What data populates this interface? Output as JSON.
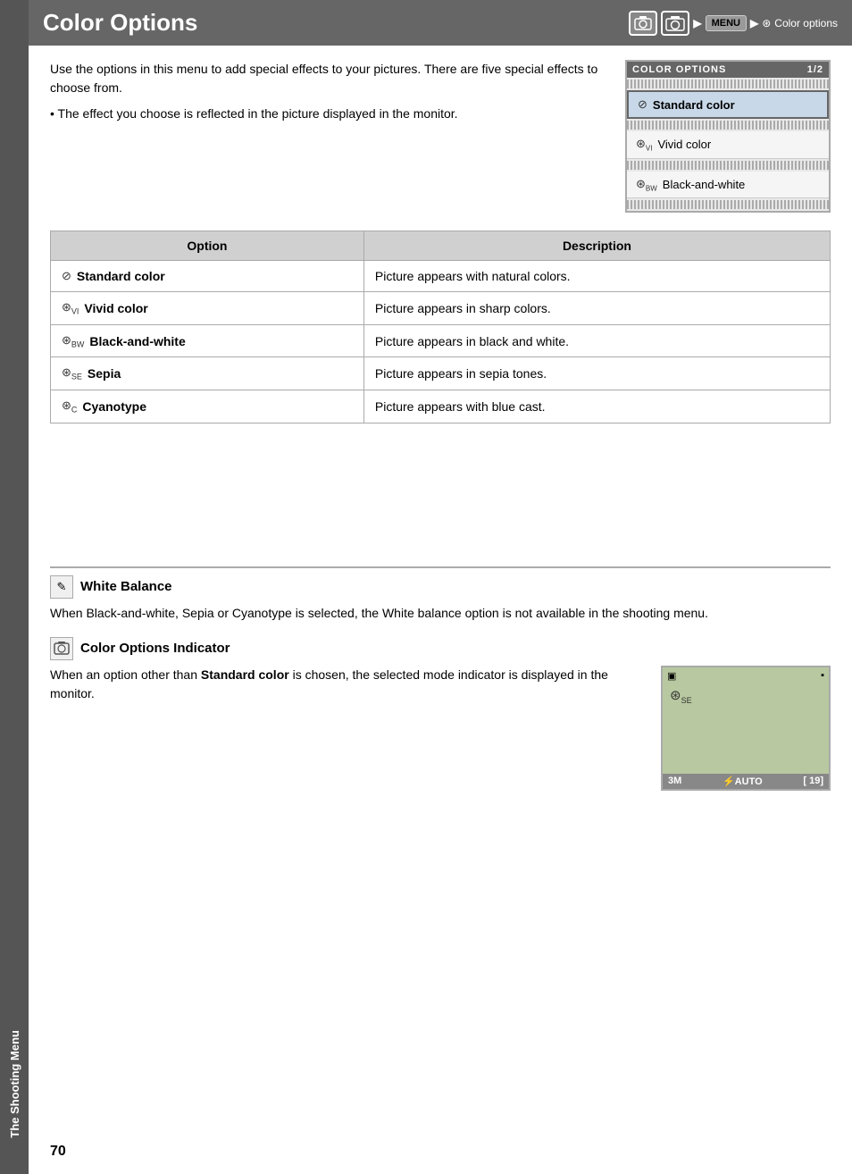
{
  "sidetab": {
    "label": "The Shooting Menu"
  },
  "header": {
    "title": "Color Options",
    "breadcrumb": {
      "arrow": "▶",
      "menu_label": "MENU",
      "icon_label": "⊛",
      "text": "Color options"
    }
  },
  "intro": {
    "paragraph1": "Use the options in this menu to add special effects to your pictures. There are five special effects to choose from.",
    "bullet1": "The effect you choose is reflected in the picture displayed in the monitor."
  },
  "camera_menu": {
    "header_left": "COLOR OPTIONS",
    "header_right": "1/2",
    "items": [
      {
        "icon": "⊘",
        "label": "Standard color",
        "selected": true
      },
      {
        "icon": "⊛VI",
        "label": "Vivid color",
        "selected": false
      },
      {
        "icon": "⊛BW",
        "label": "Black-and-white",
        "selected": false
      }
    ]
  },
  "table": {
    "col1_header": "Option",
    "col2_header": "Description",
    "rows": [
      {
        "icon": "⊘",
        "name": "Standard color",
        "description": "Picture appears with natural colors."
      },
      {
        "icon": "⊛VI",
        "name": "Vivid color",
        "description": "Picture appears in sharp colors."
      },
      {
        "icon": "⊛BW",
        "name": "Black-and-white",
        "description": "Picture appears in black and white."
      },
      {
        "icon": "⊛SE",
        "name": "Sepia",
        "description": "Picture appears in sepia tones."
      },
      {
        "icon": "⊛C",
        "name": "Cyanotype",
        "description": "Picture appears with blue cast."
      }
    ]
  },
  "notes": {
    "white_balance": {
      "icon": "✎",
      "title": "White Balance",
      "body": "When Black-and-white, Sepia or Cyanotype is selected, the White balance option is not available in the shooting menu."
    },
    "color_indicator": {
      "icon": "⊙",
      "title": "Color Options Indicator",
      "body_prefix": "When an option other than ",
      "body_bold": "Standard color",
      "body_suffix": " is chosen, the selected mode indicator is displayed in the monitor."
    }
  },
  "camera_screen": {
    "top_left_icon": "▣",
    "top_right_icon": "🔋",
    "mode_indicator": "⊛SE",
    "bottom_left": "3M",
    "bottom_middle": "⚡AUTO",
    "bottom_right": "[ 19]"
  },
  "page_number": "70"
}
